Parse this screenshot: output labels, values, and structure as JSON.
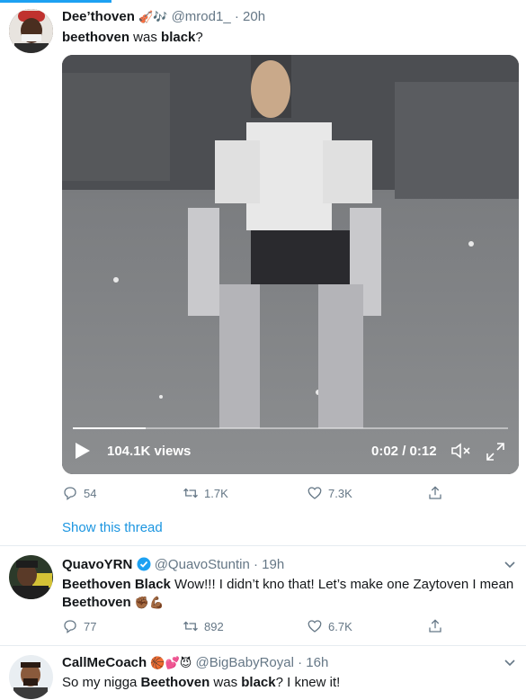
{
  "tweets": [
    {
      "name": "Dee’thoven",
      "name_emojis": "🎻🎶",
      "handle": "@mrod1_",
      "time": "· 20h",
      "text_parts": [
        "beethoven",
        " was ",
        "black",
        "?"
      ],
      "video": {
        "views": "104.1K views",
        "time": "0:02 / 0:12",
        "progress": 0.167
      },
      "replies": "54",
      "retweets": "1.7K",
      "likes": "7.3K"
    },
    {
      "name": "QuavoYRN",
      "handle": "@QuavoStuntin",
      "time": "· 19h",
      "text_parts": [
        "Beethoven Black",
        " Wow!!! I didn’t kno that! Let’s make one Zaytoven I mean ",
        "Beethoven",
        " ✊🏾💪🏾"
      ],
      "replies": "77",
      "retweets": "892",
      "likes": "6.7K"
    },
    {
      "name": "CallMeCoach",
      "name_emojis": "🏀💕😈",
      "handle": "@BigBabyRoyal",
      "time": "· 16h",
      "text_parts": [
        "So my nigga ",
        "Beethoven",
        " was ",
        "black",
        "? I knew it!"
      ]
    }
  ],
  "show_thread": "Show this thread",
  "colors": {
    "link": "#1b95e0",
    "muted": "#657786",
    "verified": "#1da1f2"
  },
  "icons": [
    "reply-icon",
    "retweet-icon",
    "like-icon",
    "share-icon",
    "play-icon",
    "volume-muted-icon",
    "fullscreen-icon",
    "chevron-down-icon",
    "verified-icon"
  ]
}
